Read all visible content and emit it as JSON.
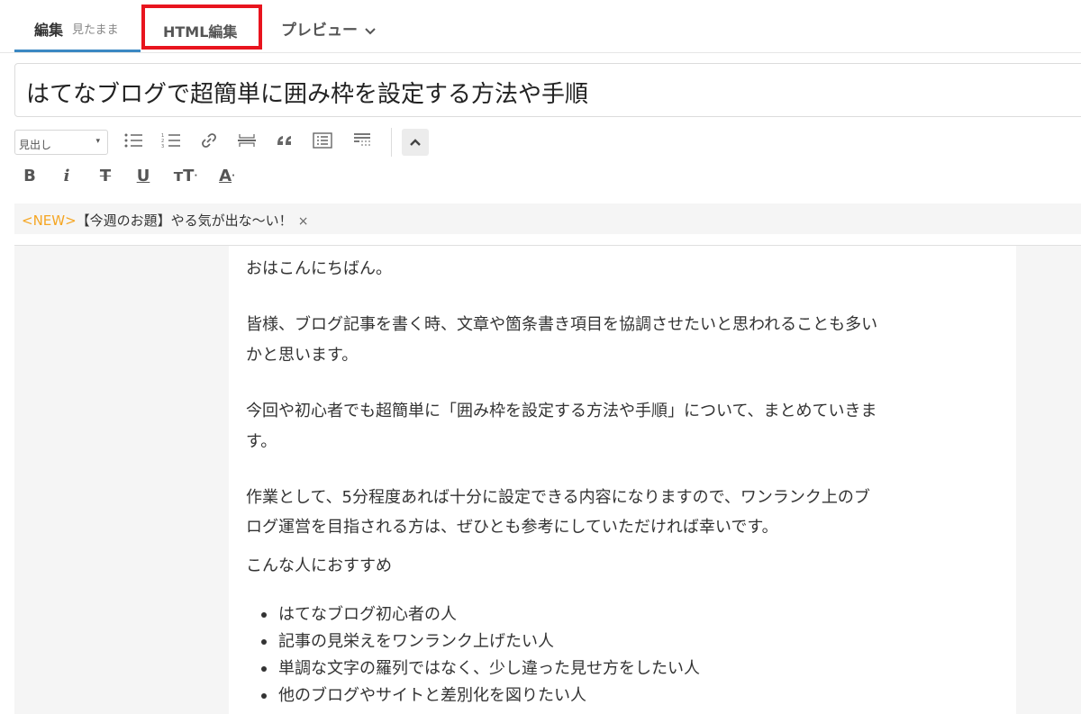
{
  "tabs": {
    "edit_label": "編集",
    "edit_sub": "見たまま",
    "html_label": "HTML編集",
    "preview_label": "プレビュー"
  },
  "title": "はてなブログで超簡単に囲み枠を設定する方法や手順",
  "toolbar": {
    "heading_select": "見出し",
    "icons": [
      "bulleted-list-icon",
      "numbered-list-icon",
      "link-icon",
      "horizontal-rule-icon",
      "quote-icon",
      "table-of-contents-icon",
      "read-more-icon",
      "collapse-icon"
    ],
    "format": {
      "bold": "B",
      "italic": "i",
      "strike": "T",
      "underline": "U",
      "size": "тT",
      "color": "A"
    }
  },
  "notice": {
    "tag": "<NEW>",
    "text": "【今週のお題】やる気が出な〜い！",
    "close": "×"
  },
  "content": {
    "greeting": "おはこんにちばん。",
    "para1_line1": "皆様、ブログ記事を書く時、文章や箇条書き項目を協調させたいと思われることも多い",
    "para1_line2": "かと思います。",
    "para2_line1": "今回や初心者でも超簡単に「囲み枠を設定する方法や手順」について、まとめていきま",
    "para2_line2": "す。",
    "para3_line1": "作業として、5分程度あれば十分に設定できる内容になりますので、ワンランク上のブ",
    "para3_line2": "ログ運営を目指される方は、ぜひとも参考にしていただければ幸いです。",
    "recommend_heading": "こんな人におすすめ",
    "bullets": [
      "はてなブログ初心者の人",
      "記事の見栄えをワンランク上げたい人",
      "単調な文字の羅列ではなく、少し違った見せ方をしたい人",
      "他のブログやサイトと差別化を図りたい人"
    ]
  }
}
